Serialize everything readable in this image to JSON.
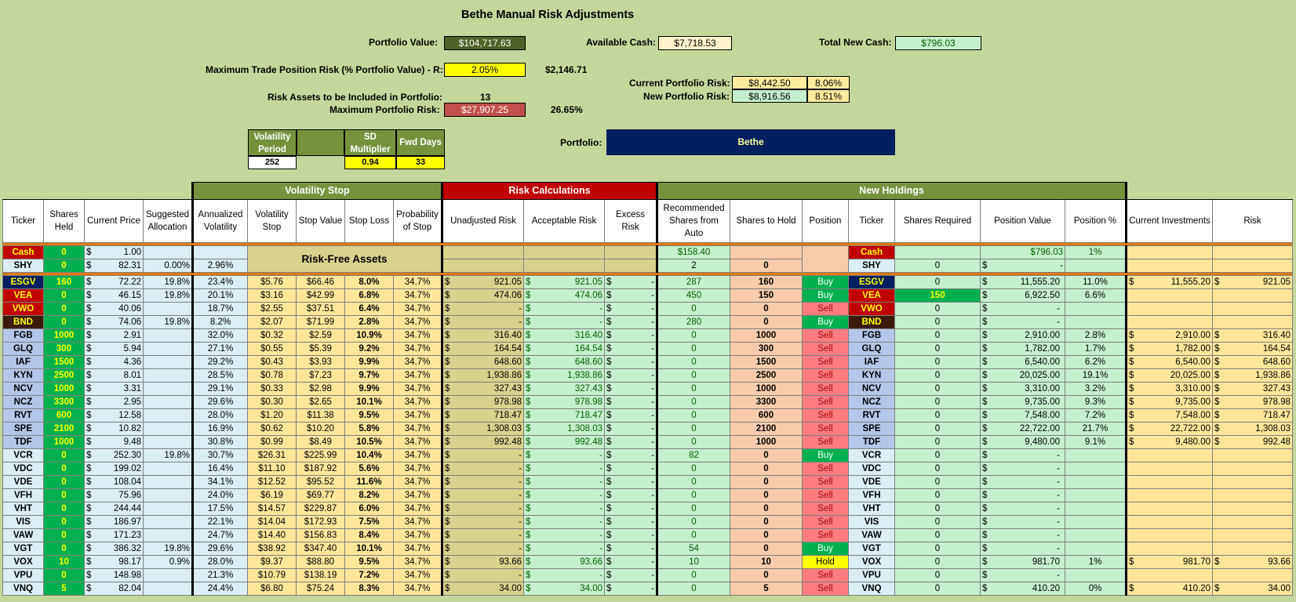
{
  "title": "Bethe Manual Risk Adjustments",
  "top": {
    "portfolio_value_label": "Portfolio Value:",
    "portfolio_value": "$104,717.63",
    "available_cash_label": "Available Cash:",
    "available_cash": "$7,718.53",
    "total_new_cash_label": "Total New Cash:",
    "total_new_cash": "$796.03",
    "max_trade_label": "Maximum Trade Position Risk (% Portfolio Value) - R:",
    "max_trade_pct": "2.05%",
    "max_trade_value": "$2,146.71",
    "current_risk_label": "Current Portfolio Risk:",
    "current_risk": "$8,442.50",
    "current_risk_pct": "8.06%",
    "new_risk_label": "New Portfolio Risk:",
    "new_risk": "$8,916.56",
    "new_risk_pct": "8.51%",
    "risk_assets_label": "Risk Assets to be Included in Portfolio:",
    "risk_assets": "13",
    "max_portfolio_risk_label": "Maximum Portfolio Risk:",
    "max_portfolio_risk": "$27,907.25",
    "max_portfolio_risk_pct": "26.65%",
    "vol_period_label": "Volatility Period",
    "vol_period": "252",
    "sd_mult_label": "SD Multiplier",
    "sd_mult": "0.94",
    "fwd_days_label": "Fwd Days",
    "fwd_days": "33",
    "portfolio_label": "Portfolio:",
    "portfolio_name": "Bethe"
  },
  "groups": {
    "vol": "Volatility Stop",
    "risk": "Risk Calculations",
    "new": "New Holdings"
  },
  "headers": [
    "Ticker",
    "Shares Held",
    "Current Price",
    "Suggested Allocation",
    "Annualized Volatility",
    "Volatility Stop",
    "Stop Value",
    "Stop Loss",
    "Probability of Stop",
    "Unadjusted Risk",
    "Acceptable Risk",
    "Excess Risk",
    "Recommended Shares from Auto",
    "Shares to Hold",
    "Position",
    "Ticker",
    "Shares Required",
    "Position Value",
    "Position %",
    "Current Investments",
    "Risk"
  ],
  "risk_free_label": "Risk-Free Assets",
  "cash_row": {
    "ticker": "Cash",
    "held": "0",
    "price": "1.00",
    "rec": "$158.40",
    "ticker2": "Cash",
    "posval": "$796.03",
    "pospct": "1%"
  },
  "shy_row": {
    "ticker": "SHY",
    "held": "0",
    "price": "82.31",
    "alloc": "0.00%",
    "vol": "2.96%",
    "rec": "2",
    "hold": "0",
    "ticker2": "SHY",
    "req": "0",
    "posval": "-"
  },
  "rows": [
    [
      "ESGV",
      "160",
      "72.22",
      "19.8%",
      "23.4%",
      "$5.76",
      "$66.46",
      "8.0%",
      "34.7%",
      "921.05",
      "921.05",
      "-",
      "287",
      "160",
      "Buy",
      "ESGV",
      "0",
      "11,555.20",
      "11.0%",
      "11,555.20",
      "921.05"
    ],
    [
      "VEA",
      "0",
      "46.15",
      "19.8%",
      "20.1%",
      "$3.16",
      "$42.99",
      "6.8%",
      "34.7%",
      "474.06",
      "474.06",
      "-",
      "450",
      "150",
      "Buy",
      "VEA",
      "150",
      "6,922.50",
      "6.6%",
      "",
      ""
    ],
    [
      "VWO",
      "0",
      "40.06",
      "",
      "18.7%",
      "$2.55",
      "$37.51",
      "6.4%",
      "34.7%",
      "-",
      "-",
      "-",
      "0",
      "0",
      "Sell",
      "VWO",
      "0",
      "-",
      "",
      "",
      ""
    ],
    [
      "BND",
      "0",
      "74.06",
      "19.8%",
      "8.2%",
      "$2.07",
      "$71.99",
      "2.8%",
      "34.7%",
      "-",
      "-",
      "-",
      "280",
      "0",
      "Buy",
      "BND",
      "0",
      "-",
      "",
      "",
      ""
    ],
    [
      "FGB",
      "1000",
      "2.91",
      "",
      "32.0%",
      "$0.32",
      "$2.59",
      "10.9%",
      "34.7%",
      "316.40",
      "316.40",
      "-",
      "0",
      "1000",
      "Sell",
      "FGB",
      "0",
      "2,910.00",
      "2.8%",
      "2,910.00",
      "316.40"
    ],
    [
      "GLQ",
      "300",
      "5.94",
      "",
      "27.1%",
      "$0.55",
      "$5.39",
      "9.2%",
      "34.7%",
      "164.54",
      "164.54",
      "-",
      "0",
      "300",
      "Sell",
      "GLQ",
      "0",
      "1,782.00",
      "1.7%",
      "1,782.00",
      "164.54"
    ],
    [
      "IAF",
      "1500",
      "4.36",
      "",
      "29.2%",
      "$0.43",
      "$3.93",
      "9.9%",
      "34.7%",
      "648.60",
      "648.60",
      "-",
      "0",
      "1500",
      "Sell",
      "IAF",
      "0",
      "6,540.00",
      "6.2%",
      "6,540.00",
      "648.60"
    ],
    [
      "KYN",
      "2500",
      "8.01",
      "",
      "28.5%",
      "$0.78",
      "$7.23",
      "9.7%",
      "34.7%",
      "1,938.86",
      "1,938.86",
      "-",
      "0",
      "2500",
      "Sell",
      "KYN",
      "0",
      "20,025.00",
      "19.1%",
      "20,025.00",
      "1,938.86"
    ],
    [
      "NCV",
      "1000",
      "3.31",
      "",
      "29.1%",
      "$0.33",
      "$2.98",
      "9.9%",
      "34.7%",
      "327.43",
      "327.43",
      "-",
      "0",
      "1000",
      "Sell",
      "NCV",
      "0",
      "3,310.00",
      "3.2%",
      "3,310.00",
      "327.43"
    ],
    [
      "NCZ",
      "3300",
      "2.95",
      "",
      "29.6%",
      "$0.30",
      "$2.65",
      "10.1%",
      "34.7%",
      "978.98",
      "978.98",
      "-",
      "0",
      "3300",
      "Sell",
      "NCZ",
      "0",
      "9,735.00",
      "9.3%",
      "9,735.00",
      "978.98"
    ],
    [
      "RVT",
      "600",
      "12.58",
      "",
      "28.0%",
      "$1.20",
      "$11.38",
      "9.5%",
      "34.7%",
      "718.47",
      "718.47",
      "-",
      "0",
      "600",
      "Sell",
      "RVT",
      "0",
      "7,548.00",
      "7.2%",
      "7,548.00",
      "718.47"
    ],
    [
      "SPE",
      "2100",
      "10.82",
      "",
      "16.9%",
      "$0.62",
      "$10.20",
      "5.8%",
      "34.7%",
      "1,308.03",
      "1,308.03",
      "-",
      "0",
      "2100",
      "Sell",
      "SPE",
      "0",
      "22,722.00",
      "21.7%",
      "22,722.00",
      "1,308.03"
    ],
    [
      "TDF",
      "1000",
      "9.48",
      "",
      "30.8%",
      "$0.99",
      "$8.49",
      "10.5%",
      "34.7%",
      "992.48",
      "992.48",
      "-",
      "0",
      "1000",
      "Sell",
      "TDF",
      "0",
      "9,480.00",
      "9.1%",
      "9,480.00",
      "992.48"
    ],
    [
      "VCR",
      "0",
      "252.30",
      "19.8%",
      "30.7%",
      "$26.31",
      "$225.99",
      "10.4%",
      "34.7%",
      "-",
      "-",
      "-",
      "82",
      "0",
      "Buy",
      "VCR",
      "0",
      "-",
      "",
      "",
      ""
    ],
    [
      "VDC",
      "0",
      "199.02",
      "",
      "16.4%",
      "$11.10",
      "$187.92",
      "5.6%",
      "34.7%",
      "-",
      "-",
      "-",
      "0",
      "0",
      "Sell",
      "VDC",
      "0",
      "-",
      "",
      "",
      ""
    ],
    [
      "VDE",
      "0",
      "108.04",
      "",
      "34.1%",
      "$12.52",
      "$95.52",
      "11.6%",
      "34.7%",
      "-",
      "-",
      "-",
      "0",
      "0",
      "Sell",
      "VDE",
      "0",
      "-",
      "",
      "",
      ""
    ],
    [
      "VFH",
      "0",
      "75.96",
      "",
      "24.0%",
      "$6.19",
      "$69.77",
      "8.2%",
      "34.7%",
      "-",
      "-",
      "-",
      "0",
      "0",
      "Sell",
      "VFH",
      "0",
      "-",
      "",
      "",
      ""
    ],
    [
      "VHT",
      "0",
      "244.44",
      "",
      "17.5%",
      "$14.57",
      "$229.87",
      "6.0%",
      "34.7%",
      "-",
      "-",
      "-",
      "0",
      "0",
      "Sell",
      "VHT",
      "0",
      "-",
      "",
      "",
      ""
    ],
    [
      "VIS",
      "0",
      "186.97",
      "",
      "22.1%",
      "$14.04",
      "$172.93",
      "7.5%",
      "34.7%",
      "-",
      "-",
      "-",
      "0",
      "0",
      "Sell",
      "VIS",
      "0",
      "-",
      "",
      "",
      ""
    ],
    [
      "VAW",
      "0",
      "171.23",
      "",
      "24.7%",
      "$14.40",
      "$156.83",
      "8.4%",
      "34.7%",
      "-",
      "-",
      "-",
      "0",
      "0",
      "Sell",
      "VAW",
      "0",
      "-",
      "",
      "",
      ""
    ],
    [
      "VGT",
      "0",
      "386.32",
      "19.8%",
      "29.6%",
      "$38.92",
      "$347.40",
      "10.1%",
      "34.7%",
      "-",
      "-",
      "-",
      "54",
      "0",
      "Buy",
      "VGT",
      "0",
      "-",
      "",
      "",
      ""
    ],
    [
      "VOX",
      "10",
      "98.17",
      "0.9%",
      "28.0%",
      "$9.37",
      "$88.80",
      "9.5%",
      "34.7%",
      "93.66",
      "93.66",
      "-",
      "10",
      "10",
      "Hold",
      "VOX",
      "0",
      "981.70",
      "1%",
      "981.70",
      "93.66"
    ],
    [
      "VPU",
      "0",
      "148.98",
      "",
      "21.3%",
      "$10.79",
      "$138.19",
      "7.2%",
      "34.7%",
      "-",
      "-",
      "-",
      "0",
      "0",
      "Sell",
      "VPU",
      "0",
      "-",
      "",
      "",
      ""
    ],
    [
      "VNQ",
      "5",
      "82.04",
      "",
      "24.4%",
      "$6.80",
      "$75.24",
      "8.3%",
      "34.7%",
      "34.00",
      "34.00",
      "-",
      "0",
      "5",
      "Sell",
      "VNQ",
      "0",
      "410.20",
      "0%",
      "410.20",
      "34.00"
    ]
  ],
  "colors": {
    "esgv": "#002060",
    "vea": "#c00000",
    "vwo": "#c00000",
    "bnd": "#3b1c0a",
    "blueTicker": "#b4c6e7",
    "buy": "#00b050",
    "sell": "#ff7c80",
    "hold": "#ffff00"
  }
}
